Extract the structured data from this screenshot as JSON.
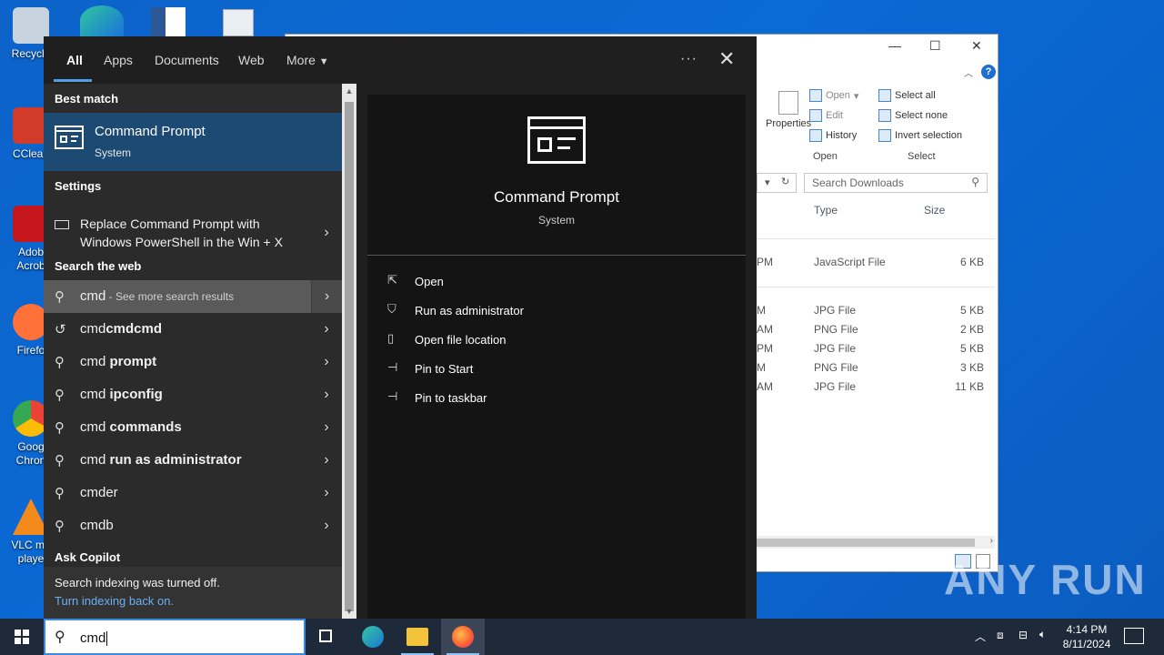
{
  "desktop": {
    "icons": [
      {
        "label": "Recycle",
        "color": "#c7d3de"
      },
      {
        "label": "CClean",
        "color": "#d23b2a"
      },
      {
        "label": "Adob Acrob",
        "color": "#c4161c"
      },
      {
        "label": "Firefo",
        "color": "#ff7139"
      },
      {
        "label": "Goog Chron",
        "color": "#34a853"
      },
      {
        "label": "VLC me playe",
        "color": "#f28a1b"
      }
    ]
  },
  "explorer": {
    "ribbon": {
      "properties": "Properties",
      "open": "Open",
      "edit": "Edit",
      "history": "History",
      "select_all": "Select all",
      "select_none": "Select none",
      "invert_selection": "Invert selection",
      "group_open": "Open",
      "group_select": "Select"
    },
    "search_placeholder": "Search Downloads",
    "columns": {
      "type": "Type",
      "size": "Size"
    },
    "files": [
      {
        "date": "PM",
        "type": "JavaScript File",
        "size": "6 KB"
      },
      {
        "date": "M",
        "type": "JPG File",
        "size": "5 KB"
      },
      {
        "date": "AM",
        "type": "PNG File",
        "size": "2 KB"
      },
      {
        "date": "PM",
        "type": "JPG File",
        "size": "5 KB"
      },
      {
        "date": "M",
        "type": "PNG File",
        "size": "3 KB"
      },
      {
        "date": "AM",
        "type": "JPG File",
        "size": "11 KB"
      }
    ]
  },
  "search": {
    "tabs": [
      "All",
      "Apps",
      "Documents",
      "Web",
      "More"
    ],
    "best_match_heading": "Best match",
    "best_match": {
      "title": "Command Prompt",
      "subtitle": "System"
    },
    "settings_heading": "Settings",
    "settings_item": "Replace Command Prompt with Windows PowerShell in the Win + X",
    "web_heading": "Search the web",
    "web_top": {
      "query": "cmd",
      "suffix": " - See more search results"
    },
    "suggestions": [
      {
        "prefix": "cmd",
        "bold": "cmdcmd",
        "icon": "history"
      },
      {
        "prefix": "cmd ",
        "bold": "prompt",
        "icon": "search"
      },
      {
        "prefix": "cmd ",
        "bold": "ipconfig",
        "icon": "search"
      },
      {
        "prefix": "cmd ",
        "bold": "commands",
        "icon": "search"
      },
      {
        "prefix": "cmd ",
        "bold": "run as administrator",
        "icon": "search"
      },
      {
        "prefix": "cmd",
        "bold": "er",
        "icon": "search",
        "plain": true
      },
      {
        "prefix": "cmd",
        "bold": "b",
        "icon": "search",
        "plain": true
      }
    ],
    "ask_copilot": "Ask Copilot",
    "indexing_off": "Search indexing was turned off.",
    "indexing_link": "Turn indexing back on.",
    "detail": {
      "title": "Command Prompt",
      "subtitle": "System",
      "actions": [
        "Open",
        "Run as administrator",
        "Open file location",
        "Pin to Start",
        "Pin to taskbar"
      ]
    },
    "query": "cmd"
  },
  "taskbar": {
    "time": "4:14 PM",
    "date": "8/11/2024"
  },
  "watermark": "ANY RUN"
}
